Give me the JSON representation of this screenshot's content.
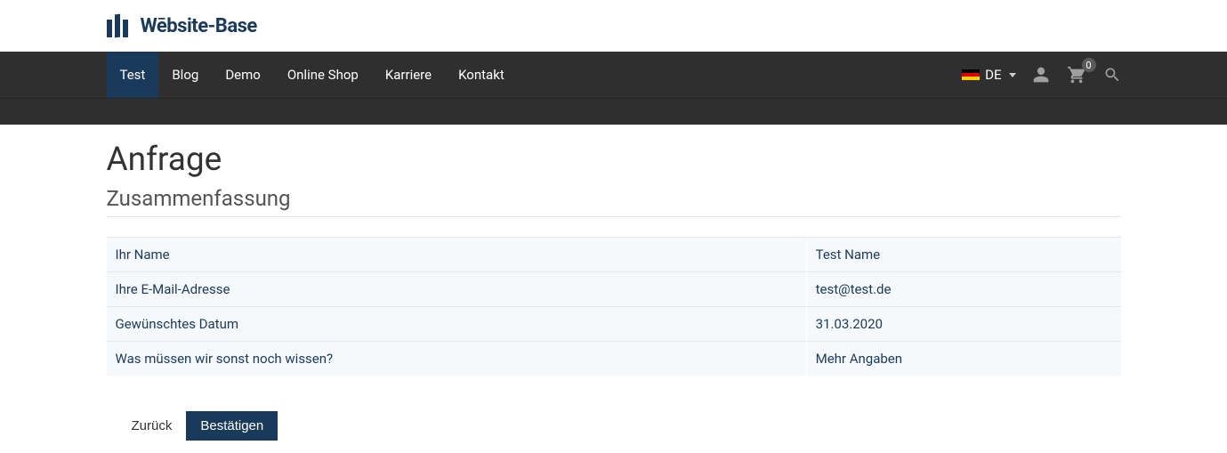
{
  "brand": {
    "name": "Wēbsite-Base"
  },
  "nav": {
    "items": [
      {
        "label": "Test",
        "active": true
      },
      {
        "label": "Blog",
        "active": false
      },
      {
        "label": "Demo",
        "active": false
      },
      {
        "label": "Online Shop",
        "active": false
      },
      {
        "label": "Karriere",
        "active": false
      },
      {
        "label": "Kontakt",
        "active": false
      }
    ],
    "language": "DE",
    "cart_count": "0"
  },
  "page": {
    "title": "Anfrage",
    "subtitle": "Zusammenfassung",
    "rows": [
      {
        "label": "Ihr Name",
        "value": "Test Name"
      },
      {
        "label": "Ihre E-Mail-Adresse",
        "value": "test@test.de"
      },
      {
        "label": "Gewünschtes Datum",
        "value": "31.03.2020"
      },
      {
        "label": "Was müssen wir sonst noch wissen?",
        "value": "Mehr Angaben"
      }
    ],
    "actions": {
      "back": "Zurück",
      "confirm": "Bestätigen"
    }
  }
}
